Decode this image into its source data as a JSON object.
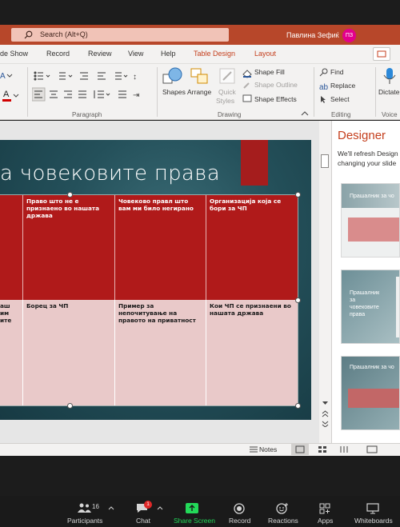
{
  "titlebar": {
    "search_placeholder": "Search (Alt+Q)",
    "user_name": "Павлина Зефиќ",
    "user_initials": "ПЗ"
  },
  "tabs": [
    {
      "label": "de Show",
      "contextual": false
    },
    {
      "label": "Record",
      "contextual": false
    },
    {
      "label": "Review",
      "contextual": false
    },
    {
      "label": "View",
      "contextual": false
    },
    {
      "label": "Help",
      "contextual": false
    },
    {
      "label": "Table Design",
      "contextual": true
    },
    {
      "label": "Layout",
      "contextual": true
    }
  ],
  "ribbon": {
    "paragraph_label": "Paragraph",
    "drawing_label": "Drawing",
    "editing_label": "Editing",
    "voice_label": "Voice",
    "shapes": "Shapes",
    "arrange": "Arrange",
    "quick_styles_1": "Quick",
    "quick_styles_2": "Styles",
    "shape_fill": "Shape Fill",
    "shape_outline": "Shape Outline",
    "shape_effects": "Shape Effects",
    "find": "Find",
    "replace": "Replace",
    "select": "Select",
    "dictate": "Dictate"
  },
  "slide": {
    "title": "а човековите права",
    "table": {
      "headers": [
        "",
        "Право што не е признаено во нашата држава",
        "Човеково прaвл што вам ми било негирано",
        "Организација која се бори за ЧП"
      ],
      "row": [
        "аш им ите",
        "Борец за ЧП",
        "Пример за непочитување на правото на приватност",
        "Кои ЧП се признаени во нашата држава"
      ]
    }
  },
  "designer": {
    "title": "Designer",
    "desc_line1": "We'll refresh Design",
    "desc_line2": "changing your slide",
    "thumb1_title": "Прашалник за чо",
    "thumb2_title_1": "Прашалник",
    "thumb2_title_2": "за",
    "thumb2_title_3": "човековите",
    "thumb2_title_4": "права",
    "thumb3_title": "Прашалник за чо"
  },
  "statusbar": {
    "notes": "Notes"
  },
  "zoom": {
    "participants_count": "16",
    "participants": "Participants",
    "chat": "Chat",
    "chat_badge": "1",
    "share_screen": "Share Screen",
    "record": "Record",
    "reactions": "Reactions",
    "apps": "Apps",
    "whiteboards": "Whiteboards"
  },
  "colors": {
    "accent": "#b7472a",
    "table_header": "#b01a1a",
    "table_body": "#e9c9c9",
    "share_green": "#23d959"
  }
}
